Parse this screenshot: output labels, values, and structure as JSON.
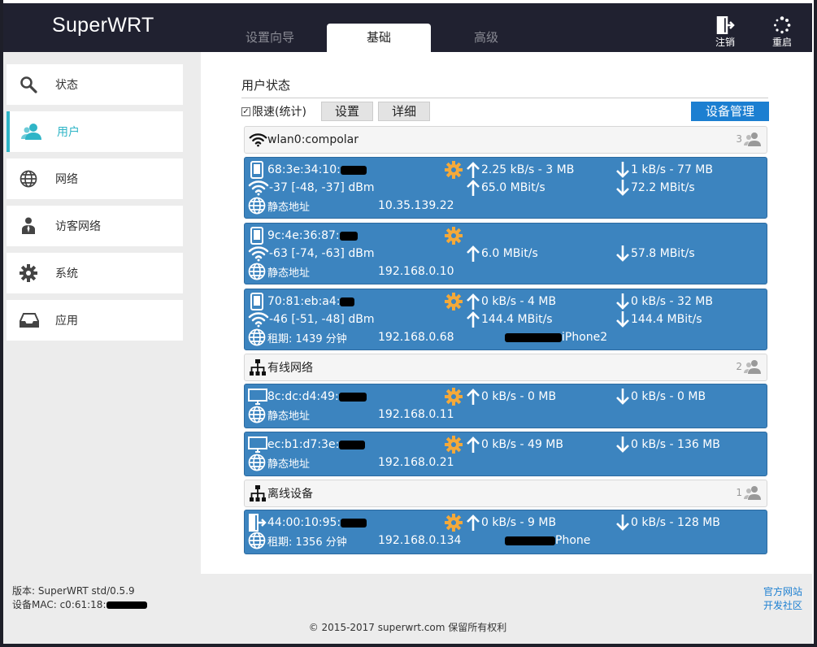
{
  "app": {
    "brand": "SuperWRT"
  },
  "tabs": [
    {
      "label": "设置向导",
      "active": false
    },
    {
      "label": "基础",
      "active": true
    },
    {
      "label": "高级",
      "active": false
    }
  ],
  "header_actions": {
    "logout": "注销",
    "reboot": "重启"
  },
  "sidebar": {
    "items": [
      {
        "label": "状态",
        "icon": "search-icon"
      },
      {
        "label": "用户",
        "icon": "users-icon",
        "active": true
      },
      {
        "label": "网络",
        "icon": "globe-icon"
      },
      {
        "label": "访客网络",
        "icon": "guest-icon"
      },
      {
        "label": "系统",
        "icon": "gear-icon"
      },
      {
        "label": "应用",
        "icon": "inbox-icon"
      }
    ]
  },
  "main": {
    "title": "用户状态",
    "limit_checkbox": {
      "label": "限速(统计)",
      "checked": true
    },
    "settings_button": "设置",
    "details_button": "详细",
    "device_manage_button": "设备管理",
    "groups": [
      {
        "name": "wlan0:compolar",
        "count": "3"
      },
      {
        "name": "有线网络",
        "count": "2"
      },
      {
        "name": "离线设备",
        "count": "1"
      }
    ],
    "devices": [
      {
        "mac": "68:3e:34:10:",
        "signal": "-37 [-48, -37] dBm",
        "addr_type": "静态地址",
        "ip": "10.35.139.22",
        "up": "2.25 kB/s - 3 MB",
        "down": "1 kB/s - 77 MB",
        "up_rate": "65.0 MBit/s",
        "down_rate": "72.2 MBit/s"
      },
      {
        "mac": "9c:4e:36:87:",
        "signal": "-63 [-74, -63] dBm",
        "addr_type": "静态地址",
        "ip": "192.168.0.10",
        "up_rate": "6.0 MBit/s",
        "down_rate": "57.8 MBit/s"
      },
      {
        "mac": "70:81:eb:a4:",
        "signal": "-46 [-51, -48] dBm",
        "addr_type": "租期: 1439 分钟",
        "ip": "192.168.0.68",
        "up": "0 kB/s - 4 MB",
        "down": "0 kB/s - 32 MB",
        "up_rate": "144.4 MBit/s",
        "down_rate": "144.4 MBit/s",
        "hostname": "iPhone2"
      },
      {
        "mac": "8c:dc:d4:49:",
        "addr_type": "静态地址",
        "ip": "192.168.0.11",
        "up": "0 kB/s - 0 MB",
        "down": "0 kB/s - 0 MB"
      },
      {
        "mac": "ec:b1:d7:3e:",
        "addr_type": "静态地址",
        "ip": "192.168.0.21",
        "up": "0 kB/s - 49 MB",
        "down": "0 kB/s - 136 MB"
      },
      {
        "mac": "44:00:10:95:",
        "addr_type": "租期: 1356 分钟",
        "ip": "192.168.0.134",
        "up": "0 kB/s - 9 MB",
        "down": "0 kB/s - 128 MB",
        "hostname": "Phone"
      }
    ]
  },
  "footer": {
    "version": "版本: SuperWRT std/0.5.9",
    "mac": "设备MAC: c0:61:18:",
    "official_site": "官方网站",
    "dev_community": "开发社区",
    "copyright": "© 2015-2017 superwrt.com 保留所有权利"
  },
  "colors": {
    "accent": "#2fb5c7",
    "device_bg": "#3c84bf",
    "primary_button": "#1c7fd1",
    "header_bg": "#202130"
  }
}
